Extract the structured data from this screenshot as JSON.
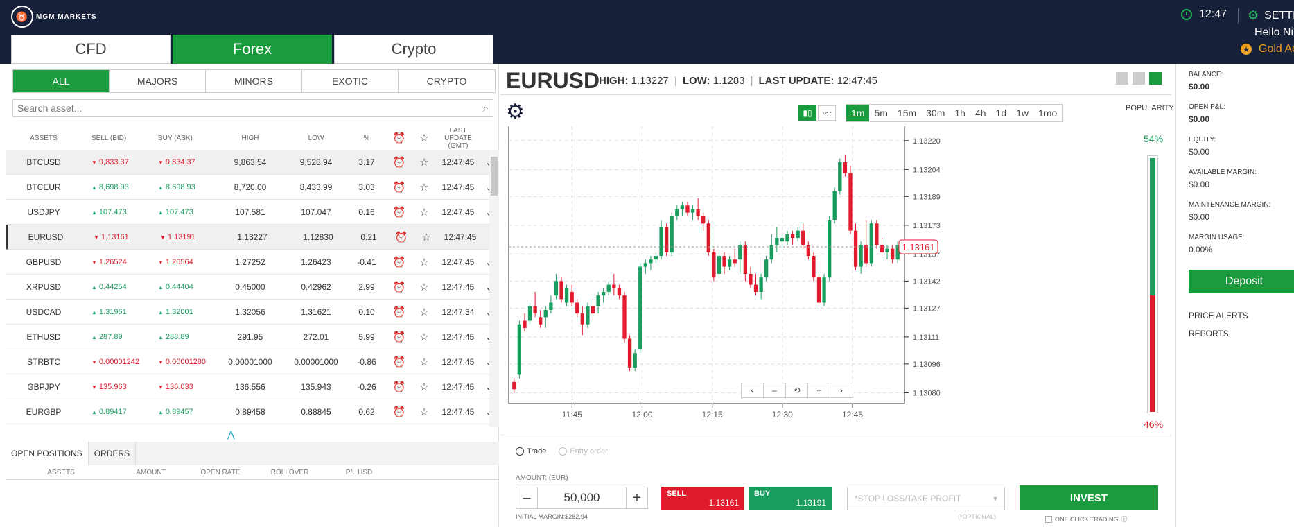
{
  "header": {
    "logo_text": "MGM MARKETS",
    "time": "12:47",
    "settings_label": "SETTI",
    "greeting": "Hello Nik",
    "account_level": "Gold Ac"
  },
  "categories": [
    "CFD",
    "Forex",
    "Crypto"
  ],
  "filters": [
    "ALL",
    "MAJORS",
    "MINORS",
    "EXOTIC",
    "CRYPTO"
  ],
  "search": {
    "placeholder": "Search asset..."
  },
  "table": {
    "headers": {
      "asset": "ASSETS",
      "sell": "SELL (BID)",
      "buy": "BUY (ASK)",
      "high": "HIGH",
      "low": "LOW",
      "pct": "%",
      "update": "LAST UPDATE (GMT)"
    },
    "rows": [
      {
        "asset": "BTCUSD",
        "sell": "9,833.37",
        "buy": "9,834.37",
        "dir": "dn",
        "high": "9,863.54",
        "low": "9,528.94",
        "pct": "3.17",
        "time": "12:47:45"
      },
      {
        "asset": "BTCEUR",
        "sell": "8,698.93",
        "buy": "8,698.93",
        "dir": "up",
        "high": "8,720.00",
        "low": "8,433.99",
        "pct": "3.03",
        "time": "12:47:45"
      },
      {
        "asset": "USDJPY",
        "sell": "107.473",
        "buy": "107.473",
        "dir": "up",
        "high": "107.581",
        "low": "107.047",
        "pct": "0.16",
        "time": "12:47:45"
      },
      {
        "asset": "EURUSD",
        "sell": "1.13161",
        "buy": "1.13191",
        "dir": "dn",
        "high": "1.13227",
        "low": "1.12830",
        "pct": "0.21",
        "time": "12:47:45"
      },
      {
        "asset": "GBPUSD",
        "sell": "1.26524",
        "buy": "1.26564",
        "dir": "dn",
        "high": "1.27252",
        "low": "1.26423",
        "pct": "-0.41",
        "time": "12:47:45"
      },
      {
        "asset": "XRPUSD",
        "sell": "0.44254",
        "buy": "0.44404",
        "dir": "up",
        "high": "0.45000",
        "low": "0.42962",
        "pct": "2.99",
        "time": "12:47:45"
      },
      {
        "asset": "USDCAD",
        "sell": "1.31961",
        "buy": "1.32001",
        "dir": "up",
        "high": "1.32056",
        "low": "1.31621",
        "pct": "0.10",
        "time": "12:47:34"
      },
      {
        "asset": "ETHUSD",
        "sell": "287.89",
        "buy": "288.89",
        "dir": "up",
        "high": "291.95",
        "low": "272.01",
        "pct": "5.99",
        "time": "12:47:45"
      },
      {
        "asset": "STRBTC",
        "sell": "0.00001242",
        "buy": "0.00001280",
        "dir": "dn",
        "high": "0.00001000",
        "low": "0.00001000",
        "pct": "-0.86",
        "time": "12:47:45"
      },
      {
        "asset": "GBPJPY",
        "sell": "135.963",
        "buy": "136.033",
        "dir": "dn",
        "high": "136.556",
        "low": "135.943",
        "pct": "-0.26",
        "time": "12:47:45"
      },
      {
        "asset": "EURGBP",
        "sell": "0.89417",
        "buy": "0.89457",
        "dir": "up",
        "high": "0.89458",
        "low": "0.88845",
        "pct": "0.62",
        "time": "12:47:45"
      }
    ]
  },
  "bottom_tabs": [
    "OPEN POSITIONS",
    "ORDERS"
  ],
  "positions_headers": [
    "ASSETS",
    "AMOUNT",
    "OPEN RATE",
    "ROLLOVER",
    "P/L USD"
  ],
  "instrument": {
    "symbol": "EURUSD",
    "high_label": "HIGH:",
    "high": "1.13227",
    "low_label": "LOW:",
    "low": "1.1283",
    "update_label": "LAST UPDATE:",
    "update": "12:47:45"
  },
  "timeframes": [
    "1m",
    "5m",
    "15m",
    "30m",
    "1h",
    "4h",
    "1d",
    "1w",
    "1mo"
  ],
  "popularity": {
    "label": "POPULARITY",
    "buy_pct": "54%",
    "sell_pct": "46%",
    "buy_fraction": 0.54
  },
  "chart_data": {
    "type": "candlestick",
    "current_price": "1.13161",
    "y_ticks": [
      "1.13220",
      "1.13204",
      "1.13189",
      "1.13173",
      "1.13157",
      "1.13142",
      "1.13127",
      "1.13111",
      "1.13096",
      "1.13080"
    ],
    "x_ticks": [
      "11:45",
      "12:00",
      "12:15",
      "12:30",
      "12:45"
    ],
    "ylim": [
      1.13074,
      1.13228
    ],
    "candles": [
      [
        1.13086,
        1.13088,
        1.1308,
        1.13082
      ],
      [
        1.1309,
        1.1312,
        1.13088,
        1.13118
      ],
      [
        1.1312,
        1.13124,
        1.13114,
        1.13116
      ],
      [
        1.1312,
        1.1313,
        1.13118,
        1.13128
      ],
      [
        1.13128,
        1.13136,
        1.13122,
        1.13124
      ],
      [
        1.13122,
        1.13126,
        1.13116,
        1.13118
      ],
      [
        1.13122,
        1.13128,
        1.13116,
        1.13126
      ],
      [
        1.13126,
        1.13134,
        1.13124,
        1.1313
      ],
      [
        1.13134,
        1.13146,
        1.13132,
        1.13142
      ],
      [
        1.13142,
        1.13144,
        1.1313,
        1.13132
      ],
      [
        1.1313,
        1.1314,
        1.13128,
        1.13138
      ],
      [
        1.13136,
        1.1314,
        1.13128,
        1.1313
      ],
      [
        1.1313,
        1.13132,
        1.13122,
        1.13124
      ],
      [
        1.13124,
        1.13128,
        1.13112,
        1.13118
      ],
      [
        1.13118,
        1.1313,
        1.13116,
        1.13128
      ],
      [
        1.13128,
        1.13132,
        1.1312,
        1.13124
      ],
      [
        1.13128,
        1.13136,
        1.13124,
        1.13134
      ],
      [
        1.13134,
        1.13138,
        1.1313,
        1.13136
      ],
      [
        1.13136,
        1.13142,
        1.13134,
        1.1314
      ],
      [
        1.1314,
        1.13146,
        1.13134,
        1.13138
      ],
      [
        1.13138,
        1.1314,
        1.13132,
        1.13134
      ],
      [
        1.13134,
        1.13136,
        1.13108,
        1.1311
      ],
      [
        1.1311,
        1.13112,
        1.13092,
        1.13094
      ],
      [
        1.13094,
        1.13104,
        1.13092,
        1.13102
      ],
      [
        1.13104,
        1.13152,
        1.13102,
        1.1315
      ],
      [
        1.1315,
        1.13154,
        1.13146,
        1.13152
      ],
      [
        1.13152,
        1.13156,
        1.13148,
        1.13154
      ],
      [
        1.13154,
        1.13158,
        1.13152,
        1.13156
      ],
      [
        1.13156,
        1.13176,
        1.13154,
        1.13172
      ],
      [
        1.13172,
        1.13174,
        1.13156,
        1.13158
      ],
      [
        1.13158,
        1.1318,
        1.13156,
        1.13178
      ],
      [
        1.13178,
        1.13184,
        1.13176,
        1.13182
      ],
      [
        1.13182,
        1.13186,
        1.13178,
        1.13184
      ],
      [
        1.13184,
        1.13186,
        1.13178,
        1.1318
      ],
      [
        1.1318,
        1.13184,
        1.13176,
        1.13182
      ],
      [
        1.13182,
        1.13188,
        1.13176,
        1.13178
      ],
      [
        1.13178,
        1.1318,
        1.1317,
        1.13174
      ],
      [
        1.13174,
        1.13176,
        1.13156,
        1.13158
      ],
      [
        1.13158,
        1.1316,
        1.13142,
        1.13144
      ],
      [
        1.13146,
        1.13158,
        1.13144,
        1.13156
      ],
      [
        1.13156,
        1.13158,
        1.13146,
        1.1315
      ],
      [
        1.1315,
        1.13156,
        1.13148,
        1.13154
      ],
      [
        1.13154,
        1.1316,
        1.1315,
        1.13152
      ],
      [
        1.13154,
        1.13164,
        1.13146,
        1.13162
      ],
      [
        1.13162,
        1.13164,
        1.13142,
        1.13146
      ],
      [
        1.13146,
        1.1315,
        1.13138,
        1.1314
      ],
      [
        1.1314,
        1.13146,
        1.13134,
        1.13136
      ],
      [
        1.13136,
        1.13146,
        1.13132,
        1.13144
      ],
      [
        1.13144,
        1.13156,
        1.13142,
        1.13154
      ],
      [
        1.13154,
        1.13168,
        1.13152,
        1.13162
      ],
      [
        1.13162,
        1.13172,
        1.13158,
        1.13166
      ],
      [
        1.13164,
        1.13168,
        1.1316,
        1.13166
      ],
      [
        1.13164,
        1.1317,
        1.13162,
        1.13168
      ],
      [
        1.13168,
        1.1317,
        1.13162,
        1.13166
      ],
      [
        1.13166,
        1.13172,
        1.13164,
        1.1317
      ],
      [
        1.1317,
        1.13174,
        1.1316,
        1.13162
      ],
      [
        1.13162,
        1.13164,
        1.13154,
        1.13156
      ],
      [
        1.13156,
        1.13158,
        1.13142,
        1.13144
      ],
      [
        1.13144,
        1.13146,
        1.13128,
        1.1313
      ],
      [
        1.1313,
        1.13146,
        1.13128,
        1.13144
      ],
      [
        1.13144,
        1.13178,
        1.13142,
        1.13176
      ],
      [
        1.13176,
        1.13194,
        1.13174,
        1.13192
      ],
      [
        1.13192,
        1.1321,
        1.1319,
        1.13208
      ],
      [
        1.13208,
        1.13212,
        1.132,
        1.13202
      ],
      [
        1.13202,
        1.13206,
        1.13168,
        1.1317
      ],
      [
        1.1317,
        1.13174,
        1.13148,
        1.1315
      ],
      [
        1.1315,
        1.13164,
        1.13146,
        1.13162
      ],
      [
        1.13162,
        1.13176,
        1.1315,
        1.13152
      ],
      [
        1.13152,
        1.13176,
        1.1315,
        1.13174
      ],
      [
        1.13174,
        1.13176,
        1.1316,
        1.13162
      ],
      [
        1.13162,
        1.13166,
        1.13156,
        1.13158
      ],
      [
        1.13158,
        1.13162,
        1.13154,
        1.1316
      ],
      [
        1.1316,
        1.13162,
        1.13152,
        1.13154
      ],
      [
        1.13154,
        1.13164,
        1.13152,
        1.13162
      ]
    ]
  },
  "chart_controls": [
    "‹",
    "–",
    "⟲",
    "+",
    "›"
  ],
  "trade": {
    "mode_trade": "Trade",
    "mode_entry": "Entry order",
    "amount_label": "AMOUNT: (EUR)",
    "amount": "50,000",
    "minus": "–",
    "plus": "+",
    "initial_margin": "INITIAL MARGIN:$282.94",
    "sell_label": "SELL",
    "sell_price": "1.13161",
    "buy_label": "BUY",
    "buy_price": "1.13191",
    "sl_placeholder": "*STOP LOSS/TAKE PROFIT",
    "optional": "(*OPTIONAL)",
    "invest": "INVEST",
    "one_click": "ONE CLICK TRADING"
  },
  "account": {
    "balance_label": "BALANCE:",
    "balance": "$0.00",
    "pnl_label": "OPEN P&L:",
    "pnl": "$0.00",
    "equity_label": "EQUITY:",
    "equity": "$0.00",
    "avail_label": "AVAILABLE MARGIN:",
    "avail": "$0.00",
    "maint_label": "MAINTENANCE MARGIN:",
    "maint": "$0.00",
    "usage_label": "MARGIN USAGE:",
    "usage": "0.00%",
    "deposit": "Deposit",
    "price_alerts": "PRICE ALERTS",
    "reports": "REPORTS"
  },
  "colors": {
    "accent": "#1a9c3e",
    "up": "#1a9c5e",
    "down": "#e01b2d",
    "header_bg": "#18213a"
  }
}
